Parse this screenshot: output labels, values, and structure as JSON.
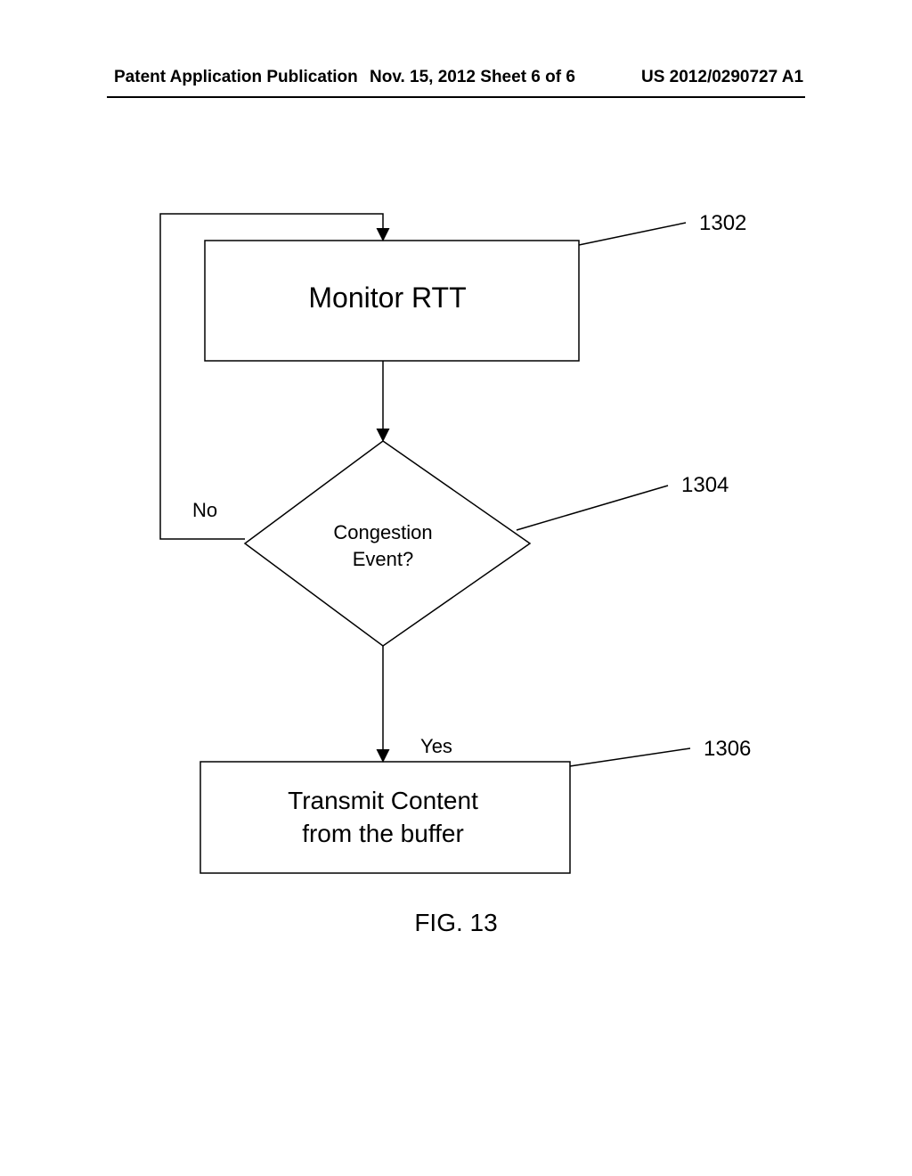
{
  "header": {
    "left": "Patent Application Publication",
    "center": "Nov. 15, 2012  Sheet 6 of 6",
    "right": "US 2012/0290727 A1"
  },
  "diagram": {
    "box1": {
      "text": "Monitor RTT",
      "ref": "1302"
    },
    "decision": {
      "line1": "Congestion",
      "line2": "Event?",
      "ref": "1304"
    },
    "box2": {
      "line1": "Transmit Content",
      "line2": "from the buffer",
      "ref": "1306"
    },
    "labels": {
      "no": "No",
      "yes": "Yes"
    }
  },
  "caption": "FIG. 13"
}
